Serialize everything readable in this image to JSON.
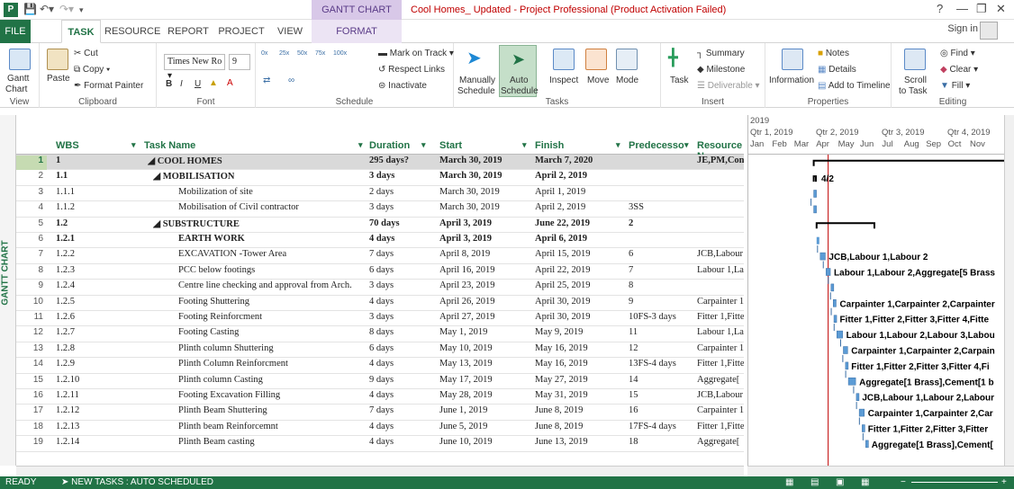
{
  "title_bar": {
    "context_tool": "GANTT CHART TOOLS",
    "window_title": "Cool Homes_ Updated - Project Professional (Product Activation Failed)",
    "help": "?"
  },
  "tabs": [
    {
      "label": "FILE"
    },
    {
      "label": "TASK"
    },
    {
      "label": "RESOURCE"
    },
    {
      "label": "REPORT"
    },
    {
      "label": "PROJECT"
    },
    {
      "label": "VIEW"
    },
    {
      "label": "FORMAT"
    }
  ],
  "account": {
    "sign_in": "Sign in"
  },
  "ribbon": {
    "view": {
      "gantt": "Gantt",
      "chart": "Chart",
      "label": "View"
    },
    "clipboard": {
      "paste": "Paste",
      "cut": "Cut",
      "copy": "Copy",
      "format_painter": "Format Painter",
      "label": "Clipboard"
    },
    "font": {
      "font_name": "Times New Ro",
      "font_size": "9",
      "bold": "B",
      "italic": "I",
      "underline": "U",
      "label": "Font"
    },
    "schedule": {
      "mark_on_track": "Mark on Track",
      "respect_links": "Respect Links",
      "inactivate": "Inactivate",
      "pcts": [
        "0x",
        "25x",
        "50x",
        "75x",
        "100x"
      ],
      "label": "Schedule"
    },
    "tasks": {
      "manually": "Manually",
      "schedule": "Schedule",
      "auto": "Auto",
      "auto_schedule": "Schedule",
      "inspect": "Inspect",
      "move": "Move",
      "mode": "Mode",
      "label": "Tasks"
    },
    "insert": {
      "task": "Task",
      "summary": "Summary",
      "milestone": "Milestone",
      "deliverable": "Deliverable",
      "label": "Insert"
    },
    "properties": {
      "information": "Information",
      "notes": "Notes",
      "details": "Details",
      "add_to_timeline": "Add to Timeline",
      "label": "Properties"
    },
    "editing": {
      "scroll": "Scroll",
      "to_task": "to Task",
      "find": "Find",
      "clear": "Clear",
      "fill": "Fill",
      "label": "Editing"
    }
  },
  "side_label": "GANTT CHART",
  "columns": {
    "wbs": "WBS",
    "task_name": "Task Name",
    "duration": "Duration",
    "start": "Start",
    "finish": "Finish",
    "predecessors": "Predecesso",
    "resource": "Resource N"
  },
  "rows": [
    {
      "n": "1",
      "wbs": "1",
      "name": "◢ COOL HOMES",
      "dur": "295 days?",
      "start": "March 30, 2019",
      "finish": "March 7, 2020",
      "pred": "",
      "res": "JE,PM,Con",
      "level": 0,
      "bold": true
    },
    {
      "n": "2",
      "wbs": "1.1",
      "name": "◢ MOBILISATION",
      "dur": "3 days",
      "start": "March 30, 2019",
      "finish": "April 2, 2019",
      "pred": "",
      "res": "",
      "level": 1,
      "bold": true
    },
    {
      "n": "3",
      "wbs": "1.1.1",
      "name": "Mobilization of site",
      "dur": "2 days",
      "start": "March 30, 2019",
      "finish": "April 1, 2019",
      "pred": "",
      "res": "",
      "level": 2,
      "bold": false
    },
    {
      "n": "4",
      "wbs": "1.1.2",
      "name": "Mobilisation of Civil contractor",
      "dur": "3 days",
      "start": "March 30, 2019",
      "finish": "April 2, 2019",
      "pred": "3SS",
      "res": "",
      "level": 2,
      "bold": false
    },
    {
      "n": "5",
      "wbs": "1.2",
      "name": "◢ SUBSTRUCTURE",
      "dur": "70 days",
      "start": "April 3, 2019",
      "finish": "June 22, 2019",
      "pred": "2",
      "res": "",
      "level": 1,
      "bold": true
    },
    {
      "n": "6",
      "wbs": "1.2.1",
      "name": "EARTH WORK",
      "dur": "4 days",
      "start": "April 3, 2019",
      "finish": "April 6, 2019",
      "pred": "",
      "res": "",
      "level": 2,
      "bold": true
    },
    {
      "n": "7",
      "wbs": "1.2.2",
      "name": "EXCAVATION -Tower Area",
      "dur": "7 days",
      "start": "April 8, 2019",
      "finish": "April 15, 2019",
      "pred": "6",
      "res": "JCB,Labour",
      "level": 2,
      "bold": false
    },
    {
      "n": "8",
      "wbs": "1.2.3",
      "name": "PCC below footings",
      "dur": "6 days",
      "start": "April 16, 2019",
      "finish": "April 22, 2019",
      "pred": "7",
      "res": "Labour 1,La",
      "level": 2,
      "bold": false
    },
    {
      "n": "9",
      "wbs": "1.2.4",
      "name": "Centre line checking and approval from Arch.",
      "dur": "3 days",
      "start": "April 23, 2019",
      "finish": "April 25, 2019",
      "pred": "8",
      "res": "",
      "level": 2,
      "bold": false
    },
    {
      "n": "10",
      "wbs": "1.2.5",
      "name": "Footing Shuttering",
      "dur": "4 days",
      "start": "April 26, 2019",
      "finish": "April 30, 2019",
      "pred": "9",
      "res": "Carpainter 1",
      "level": 2,
      "bold": false
    },
    {
      "n": "11",
      "wbs": "1.2.6",
      "name": "Footing Reinforcment",
      "dur": "3 days",
      "start": "April 27, 2019",
      "finish": "April 30, 2019",
      "pred": "10FS-3 days",
      "res": "Fitter 1,Fitte",
      "level": 2,
      "bold": false
    },
    {
      "n": "12",
      "wbs": "1.2.7",
      "name": "Footing Casting",
      "dur": "8 days",
      "start": "May 1, 2019",
      "finish": "May 9, 2019",
      "pred": "11",
      "res": "Labour 1,La",
      "level": 2,
      "bold": false
    },
    {
      "n": "13",
      "wbs": "1.2.8",
      "name": "Plinth column Shuttering",
      "dur": "6 days",
      "start": "May 10, 2019",
      "finish": "May 16, 2019",
      "pred": "12",
      "res": "Carpainter 1",
      "level": 2,
      "bold": false
    },
    {
      "n": "14",
      "wbs": "1.2.9",
      "name": "Plinth Column Reinforcment",
      "dur": "4 days",
      "start": "May 13, 2019",
      "finish": "May 16, 2019",
      "pred": "13FS-4 days",
      "res": "Fitter 1,Fitte",
      "level": 2,
      "bold": false
    },
    {
      "n": "15",
      "wbs": "1.2.10",
      "name": "Plinth column Casting",
      "dur": "9 days",
      "start": "May 17, 2019",
      "finish": "May 27, 2019",
      "pred": "14",
      "res": "Aggregate[",
      "level": 2,
      "bold": false
    },
    {
      "n": "16",
      "wbs": "1.2.11",
      "name": "Footing Excavation Filling",
      "dur": "4 days",
      "start": "May 28, 2019",
      "finish": "May 31, 2019",
      "pred": "15",
      "res": "JCB,Labour",
      "level": 2,
      "bold": false
    },
    {
      "n": "17",
      "wbs": "1.2.12",
      "name": "Plinth Beam Shuttering",
      "dur": "7 days",
      "start": "June 1, 2019",
      "finish": "June 8, 2019",
      "pred": "16",
      "res": "Carpainter 1",
      "level": 2,
      "bold": false
    },
    {
      "n": "18",
      "wbs": "1.2.13",
      "name": "Plinth beam Reinforcemnt",
      "dur": "4 days",
      "start": "June 5, 2019",
      "finish": "June 8, 2019",
      "pred": "17FS-4 days",
      "res": "Fitter 1,Fitte",
      "level": 2,
      "bold": false
    },
    {
      "n": "19",
      "wbs": "1.2.14",
      "name": "Plinth Beam casting",
      "dur": "4 days",
      "start": "June 10, 2019",
      "finish": "June 13, 2019",
      "pred": "18",
      "res": "Aggregate[",
      "level": 2,
      "bold": false
    }
  ],
  "gantt": {
    "year": "2019",
    "quarters": [
      "Qtr 1, 2019",
      "Qtr 2, 2019",
      "Qtr 3, 2019",
      "Qtr 4, 2019"
    ],
    "months": [
      "Jan",
      "Feb",
      "Mar",
      "Apr",
      "May",
      "Jun",
      "Jul",
      "Aug",
      "Sep",
      "Oct",
      "Nov"
    ],
    "milestone_label": "4/2",
    "bar_labels": [
      {
        "row": 7,
        "text": "JCB,Labour 1,Labour 2"
      },
      {
        "row": 8,
        "text": "Labour 1,Labour 2,Aggregate[5 Brass"
      },
      {
        "row": 10,
        "text": "Carpainter 1,Carpainter 2,Carpainter"
      },
      {
        "row": 11,
        "text": "Fitter 1,Fitter 2,Fitter 3,Fitter 4,Fitte"
      },
      {
        "row": 12,
        "text": "Labour 1,Labour 2,Labour 3,Labou"
      },
      {
        "row": 13,
        "text": "Carpainter 1,Carpainter 2,Carpain"
      },
      {
        "row": 14,
        "text": "Fitter 1,Fitter 2,Fitter 3,Fitter 4,Fi"
      },
      {
        "row": 15,
        "text": "Aggregate[1 Brass],Cement[1 b"
      },
      {
        "row": 16,
        "text": "JCB,Labour 1,Labour 2,Labour"
      },
      {
        "row": 17,
        "text": "Carpainter 1,Carpainter 2,Car"
      },
      {
        "row": 18,
        "text": "Fitter 1,Fitter 2,Fitter 3,Fitter"
      },
      {
        "row": 19,
        "text": "Aggregate[1 Brass],Cement["
      }
    ]
  },
  "status_bar": {
    "ready": "READY",
    "new_tasks": "NEW TASKS : AUTO SCHEDULED"
  }
}
